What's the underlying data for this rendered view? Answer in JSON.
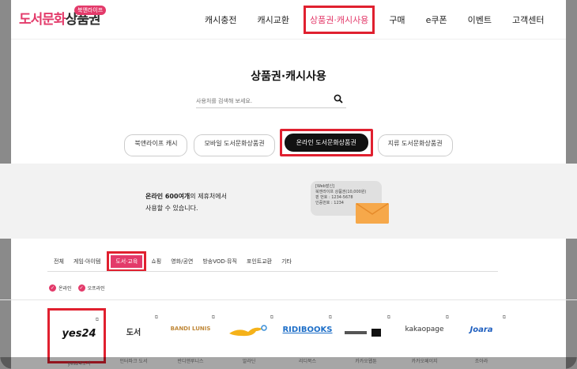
{
  "header": {
    "logo_badge": "북앤라이프",
    "logo_main": "도서문화",
    "logo_sub": "상품권",
    "nav": [
      "캐시충전",
      "캐시교환",
      "상품권·캐시사용",
      "구매",
      "e쿠폰",
      "이벤트",
      "고객센터"
    ]
  },
  "main": {
    "title": "상품권·캐시사용",
    "search_placeholder": "사용처를 검색해 보세요.",
    "pills": [
      "북앤라이프 캐시",
      "모바일 도서문화상품권",
      "온라인 도서문화상품권",
      "지류 도서문화상품권"
    ],
    "band": {
      "line1_bold": "온라인 600여개",
      "line1_rest": "의 제휴처에서",
      "line2": "사용할 수 있습니다.",
      "msg_lines": [
        "[Web발신]",
        "북앤라이프 상품권(10,000원)",
        "핀 번호 : 1234-5678",
        "인증번호 : 1234"
      ]
    },
    "categories": [
      "전체",
      "게임·아이템",
      "도서·교육",
      "쇼핑",
      "영화/공연",
      "방송VOD·뮤직",
      "포인트교환",
      "기타"
    ],
    "filters": [
      "온라인",
      "오프라인"
    ],
    "partners": [
      {
        "logo": "yes24",
        "name": "yes24도서"
      },
      {
        "logo": "도서",
        "name": "인터파크 도서"
      },
      {
        "logo": "BANDI LUNIS",
        "name": "반디앤루니스"
      },
      {
        "logo": "",
        "name": "알라딘"
      },
      {
        "logo": "RIDIBOOKS",
        "name": "리디북스"
      },
      {
        "logo": "",
        "name": "카카오웹툰"
      },
      {
        "logo": "kakaopage",
        "name": "카카오페이지"
      },
      {
        "logo": "Joara",
        "name": "조아라"
      }
    ]
  },
  "colors": {
    "accent": "#e33a6a",
    "highlight": "#e0202f"
  }
}
